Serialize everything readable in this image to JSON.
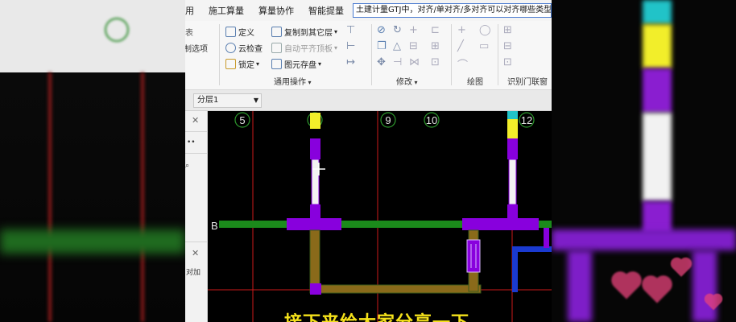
{
  "menubar": {
    "items": [
      "用",
      "施工算量",
      "算量协作",
      "智能提量"
    ],
    "search_value": "土建计量GTJ中，对齐/单对齐/多对齐可以对齐哪些类型"
  },
  "ribbon": {
    "left_clip": [
      "表",
      "制选项"
    ],
    "general": {
      "define": "定义",
      "cloud_check": "云检查",
      "lock": "锁定",
      "copy_to_floor": "复制到其它层",
      "auto_flat_slab": "自动平齐顶板",
      "save_element": "图元存盘",
      "label": "通用操作"
    },
    "modify_label": "修改",
    "draw_label": "绘图",
    "recognize_label": "识别门联窗"
  },
  "layerbar": {
    "layer_value": "分层1"
  },
  "leftpanel": {
    "text": "对加"
  },
  "canvas": {
    "axis_labels": [
      "5",
      "9",
      "10",
      "12"
    ],
    "row_label": "B",
    "subtitle": "接下来给大家分享一下"
  },
  "colors": {
    "wall": "#8a6a1a",
    "column": "#8800dd",
    "beam_green": "#1b8a1b",
    "axis_red": "#cc1a1a",
    "subtitle": "#f5e21a"
  }
}
